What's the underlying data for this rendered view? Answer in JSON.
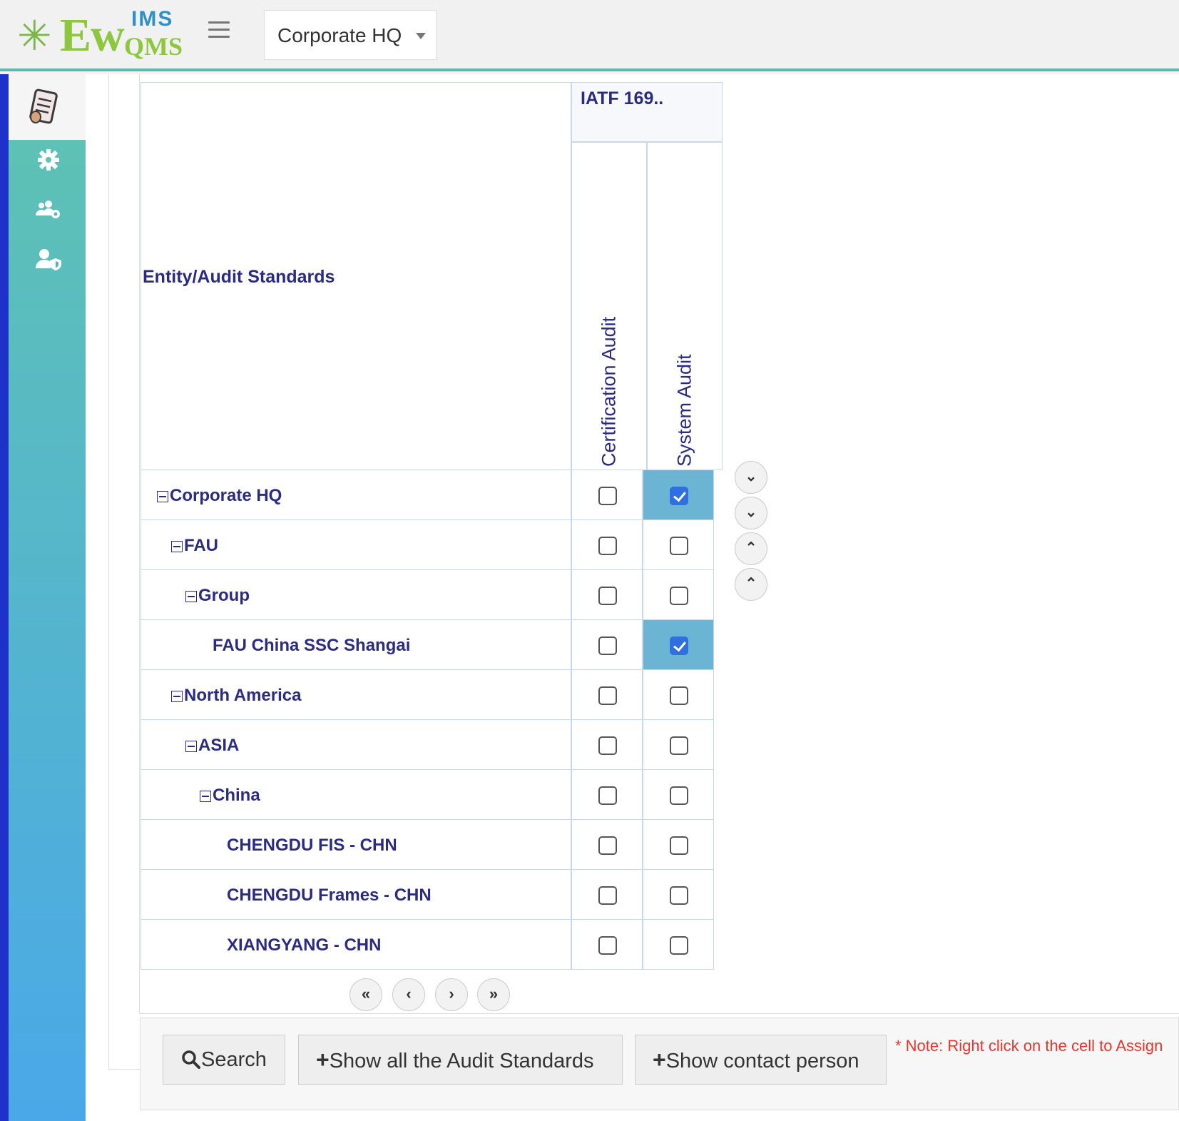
{
  "header": {
    "logo_ew": "Ew",
    "logo_ims": "IMS",
    "logo_qms": "QMS",
    "entity_select": "Corporate HQ"
  },
  "sidebar": {
    "items": [
      {
        "icon": "document-icon"
      },
      {
        "icon": "gear-icon"
      },
      {
        "icon": "users-gear-icon"
      },
      {
        "icon": "user-shield-icon"
      }
    ]
  },
  "grid": {
    "entity_header": "Entity/Audit Standards",
    "standard_header": "IATF 169..",
    "audit_types": [
      "Certification Audit",
      "System Audit"
    ],
    "rows": [
      {
        "name": "Corporate HQ",
        "level": 0,
        "expandable": true,
        "cert": false,
        "system": true
      },
      {
        "name": "FAU",
        "level": 1,
        "expandable": true,
        "cert": false,
        "system": false
      },
      {
        "name": "Group",
        "level": 2,
        "expandable": true,
        "cert": false,
        "system": false
      },
      {
        "name": "FAU China SSC Shangai",
        "level": 3,
        "expandable": false,
        "cert": false,
        "system": true
      },
      {
        "name": "North America",
        "level": 1,
        "expandable": true,
        "cert": false,
        "system": false
      },
      {
        "name": "ASIA",
        "level": 2,
        "expandable": true,
        "cert": false,
        "system": false
      },
      {
        "name": "China",
        "level": 3,
        "expandable": true,
        "cert": false,
        "system": false
      },
      {
        "name": "CHENGDU FIS - CHN",
        "level": 4,
        "expandable": false,
        "cert": false,
        "system": false
      },
      {
        "name": "CHENGDU Frames - CHN",
        "level": 4,
        "expandable": false,
        "cert": false,
        "system": false
      },
      {
        "name": "XIANGYANG - CHN",
        "level": 4,
        "expandable": false,
        "cert": false,
        "system": false
      }
    ],
    "scroll_buttons": [
      "»",
      "›",
      "‹",
      "«"
    ],
    "page_buttons": [
      "«",
      "‹",
      "›",
      "»"
    ]
  },
  "footer": {
    "search_label": "Search",
    "show_standards_label": "Show all the Audit Standards",
    "show_contact_label": "Show contact person",
    "note": "* Note: Right click on the cell to Assign"
  },
  "colors": {
    "accent": "#5fb9ac",
    "header_text": "#2b2b82",
    "selected_cell": "#6cb4d3",
    "note": "#e8352b"
  }
}
